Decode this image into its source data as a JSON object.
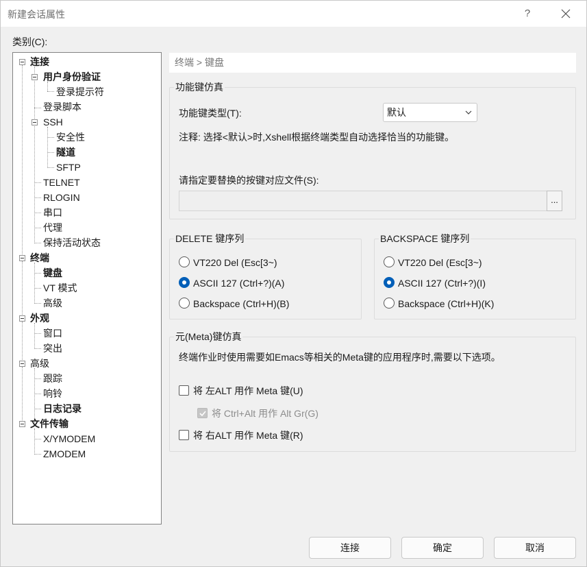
{
  "window": {
    "title": "新建会话属性",
    "help": "?"
  },
  "category_label": "类别(C):",
  "tree": [
    {
      "label": "连接"
    },
    {
      "label": "用户身份验证"
    },
    {
      "label": "登录提示符"
    },
    {
      "label": "登录脚本"
    },
    {
      "label": "SSH"
    },
    {
      "label": "安全性"
    },
    {
      "label": "隧道"
    },
    {
      "label": "SFTP"
    },
    {
      "label": "TELNET"
    },
    {
      "label": "RLOGIN"
    },
    {
      "label": "串口"
    },
    {
      "label": "代理"
    },
    {
      "label": "保持活动状态"
    },
    {
      "label": "终端"
    },
    {
      "label": "键盘"
    },
    {
      "label": "VT 模式"
    },
    {
      "label": "高级"
    },
    {
      "label": "外观"
    },
    {
      "label": "窗口"
    },
    {
      "label": "突出"
    },
    {
      "label": "高级"
    },
    {
      "label": "跟踪"
    },
    {
      "label": "响铃"
    },
    {
      "label": "日志记录"
    },
    {
      "label": "文件传输"
    },
    {
      "label": "X/YMODEM"
    },
    {
      "label": "ZMODEM"
    }
  ],
  "breadcrumb": "终端 > 键盘",
  "function_keys": {
    "group_title": "功能键仿真",
    "type_label": "功能键类型(T):",
    "type_value": "默认",
    "note": "注释: 选择<默认>时,Xshell根据终端类型自动选择恰当的功能键。",
    "file_label": "请指定要替换的按键对应文件(S):",
    "file_value": "",
    "browse_label": "..."
  },
  "delete_seq": {
    "group_title": "DELETE 键序列",
    "options": [
      {
        "label": "VT220 Del (Esc[3~)",
        "checked": false
      },
      {
        "label": "ASCII 127 (Ctrl+?)(A)",
        "checked": true
      },
      {
        "label": "Backspace (Ctrl+H)(B)",
        "checked": false
      }
    ]
  },
  "backspace_seq": {
    "group_title": "BACKSPACE 键序列",
    "options": [
      {
        "label": "VT220 Del (Esc[3~)",
        "checked": false
      },
      {
        "label": "ASCII 127 (Ctrl+?)(I)",
        "checked": true
      },
      {
        "label": "Backspace (Ctrl+H)(K)",
        "checked": false
      }
    ]
  },
  "meta": {
    "group_title": "元(Meta)键仿真",
    "description": "终端作业时使用需要如Emacs等相关的Meta键的应用程序时,需要以下选项。",
    "left_alt": {
      "label": "将 左ALT 用作 Meta 键(U)",
      "checked": false
    },
    "ctrl_alt": {
      "label": "将 Ctrl+Alt 用作 Alt Gr(G)",
      "checked": true,
      "disabled": true
    },
    "right_alt": {
      "label": "将 右ALT 用作 Meta 键(R)",
      "checked": false
    }
  },
  "buttons": {
    "connect": "连接",
    "ok": "确定",
    "cancel": "取消"
  },
  "colors": {
    "accent": "#005fb8",
    "window_bg": "#f0f0f0"
  }
}
